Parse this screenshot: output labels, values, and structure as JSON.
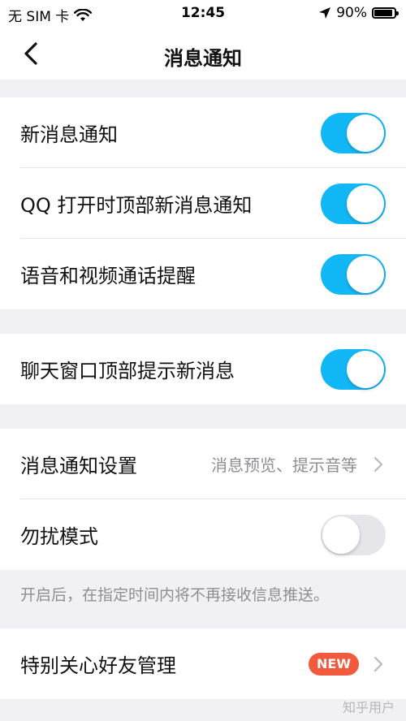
{
  "status_bar": {
    "carrier": "无 SIM 卡",
    "time": "12:45",
    "battery_text": "90%",
    "battery_level": 0.9
  },
  "nav": {
    "title": "消息通知"
  },
  "group1": [
    {
      "label": "新消息通知",
      "toggle": "on"
    },
    {
      "label": "QQ 打开时顶部新消息通知",
      "toggle": "on"
    },
    {
      "label": "语音和视频通话提醒",
      "toggle": "on"
    }
  ],
  "group2": [
    {
      "label": "聊天窗口顶部提示新消息",
      "toggle": "on"
    }
  ],
  "group3": {
    "settings_label": "消息通知设置",
    "settings_detail": "消息预览、提示音等",
    "dnd_label": "勿扰模式",
    "dnd_toggle": "off"
  },
  "hint": "开启后，在指定时间内将不再接收信息推送。",
  "group4": {
    "label": "特别关心好友管理",
    "badge": "NEW"
  },
  "watermark": "知乎用户",
  "colors": {
    "switch_on": "#12b7f5",
    "switch_off": "#e5e5ea",
    "badge": "#f15a3c"
  }
}
